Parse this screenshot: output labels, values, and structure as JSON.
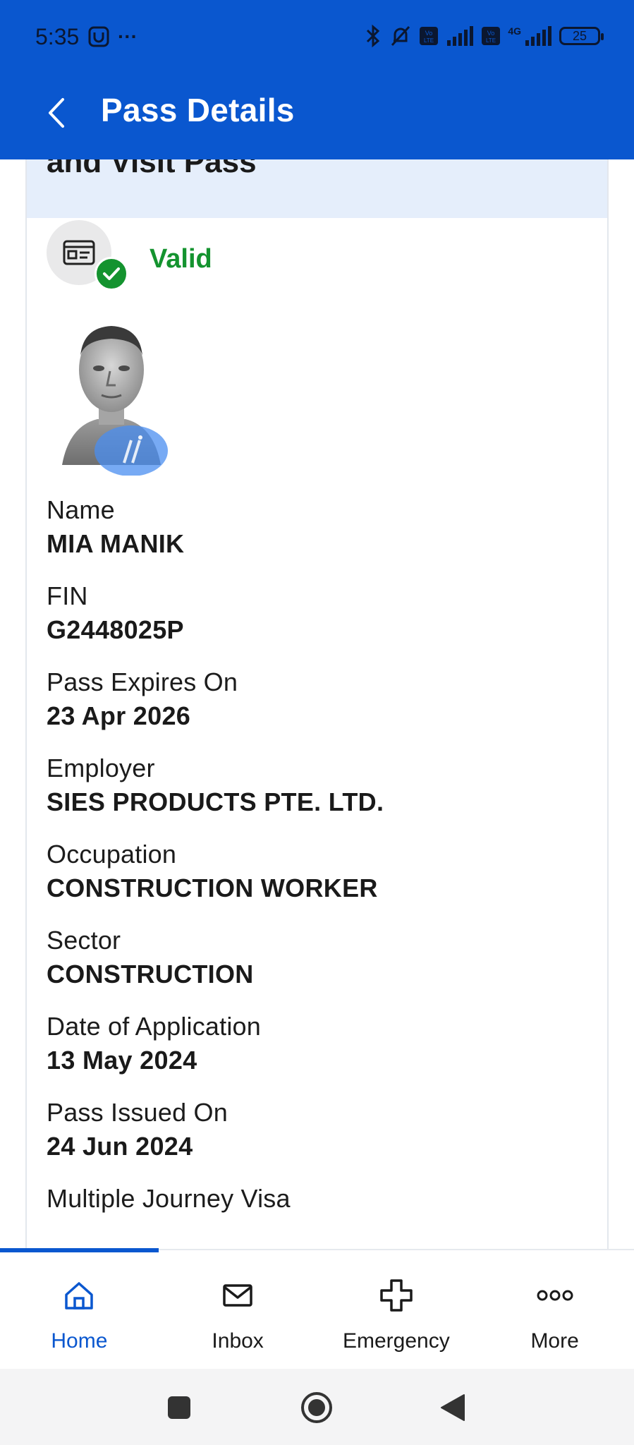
{
  "status_bar": {
    "time": "5:35",
    "more_dots": "···",
    "battery": "25",
    "network": "4G"
  },
  "app_bar": {
    "title": "Pass Details",
    "back_icon": "chevron-left-icon"
  },
  "card": {
    "header_text": "and Visit Pass",
    "status": "Valid",
    "status_color": "#14932f",
    "fields": [
      {
        "label": "Name",
        "value": "MIA MANIK"
      },
      {
        "label": "FIN",
        "value": "G2448025P"
      },
      {
        "label": "Pass Expires On",
        "value": "23 Apr 2026"
      },
      {
        "label": "Employer",
        "value": "SIES PRODUCTS PTE. LTD."
      },
      {
        "label": "Occupation",
        "value": "CONSTRUCTION WORKER"
      },
      {
        "label": "Sector",
        "value": "CONSTRUCTION"
      },
      {
        "label": "Date of Application",
        "value": "13 May 2024"
      },
      {
        "label": "Pass Issued On",
        "value": "24 Jun 2024"
      },
      {
        "label": "Multiple Journey Visa",
        "value": ""
      }
    ]
  },
  "bottom_nav": {
    "items": [
      {
        "label": "Home",
        "icon": "home-icon",
        "active": true
      },
      {
        "label": "Inbox",
        "icon": "mail-icon",
        "active": false
      },
      {
        "label": "Emergency",
        "icon": "cross-icon",
        "active": false
      },
      {
        "label": "More",
        "icon": "more-dots-icon",
        "active": false
      }
    ]
  },
  "colors": {
    "brand_blue": "#0a57cf",
    "valid_green": "#14932f",
    "header_tint": "#e5eefb"
  }
}
